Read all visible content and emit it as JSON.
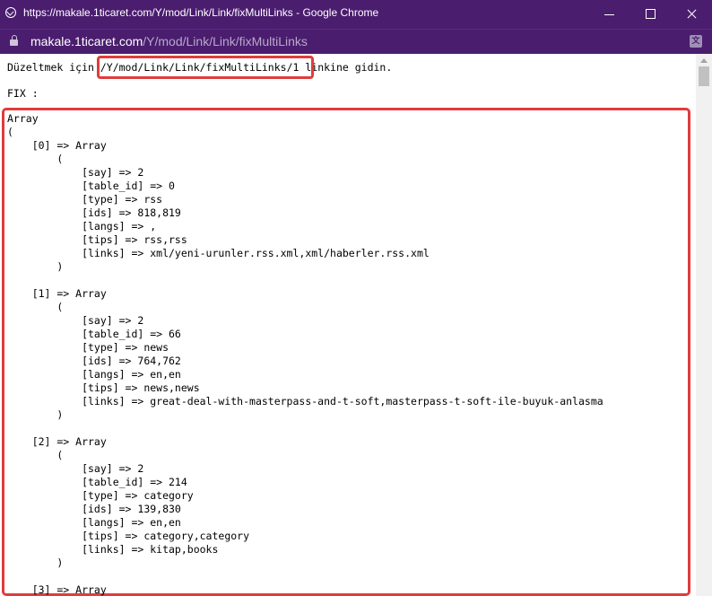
{
  "window": {
    "title": "https://makale.1ticaret.com/Y/mod/Link/Link/fixMultiLinks - Google Chrome"
  },
  "address": {
    "host": "makale.1ticaret.com",
    "path": "/Y/mod/Link/Link/fixMultiLinks"
  },
  "page": {
    "message_prefix": "Düzeltmek için ",
    "message_link": "/Y/mod/Link/Link/fixMultiLinks/1",
    "message_suffix": " linkine gidin.",
    "fix_label": "FIX :"
  },
  "dump_lines": [
    "Array",
    "(",
    "    [0] => Array",
    "        (",
    "            [say] => 2",
    "            [table_id] => 0",
    "            [type] => rss",
    "            [ids] => 818,819",
    "            [langs] => ,",
    "            [tips] => rss,rss",
    "            [links] => xml/yeni-urunler.rss.xml,xml/haberler.rss.xml",
    "        )",
    "",
    "    [1] => Array",
    "        (",
    "            [say] => 2",
    "            [table_id] => 66",
    "            [type] => news",
    "            [ids] => 764,762",
    "            [langs] => en,en",
    "            [tips] => news,news",
    "            [links] => great-deal-with-masterpass-and-t-soft,masterpass-t-soft-ile-buyuk-anlasma",
    "        )",
    "",
    "    [2] => Array",
    "        (",
    "            [say] => 2",
    "            [table_id] => 214",
    "            [type] => category",
    "            [ids] => 139,830",
    "            [langs] => en,en",
    "            [tips] => category,category",
    "            [links] => kitap,books",
    "        )",
    "",
    "    [3] => Array"
  ],
  "colors": {
    "titlebar": "#4a1d6e",
    "highlight": "#e03c3c"
  },
  "icons": {
    "favicon": "globe-icon",
    "lock": "lock-icon",
    "translate": "translate-icon"
  }
}
